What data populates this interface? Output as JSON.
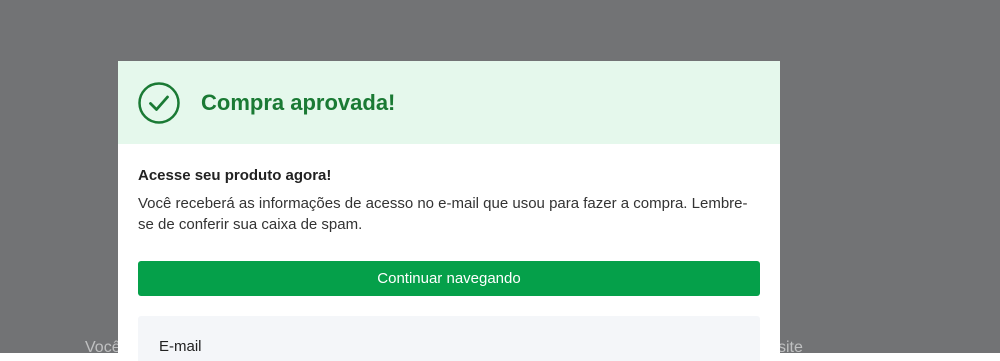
{
  "background": {
    "text_left": "Você",
    "text_right": "site"
  },
  "modal": {
    "title": "Compra aprovada!",
    "icon": "check-circle-icon",
    "accent_color": "#1a7a34",
    "header_bg": "#e5f8ec",
    "heading": "Acesse seu produto agora!",
    "message": "Você receberá as informações de acesso no e-mail que usou para fazer a compra. Lembre-se de conferir sua caixa de spam.",
    "continue_label": "Continuar navegando",
    "button_color": "#05a04a",
    "email_label": "E-mail"
  }
}
